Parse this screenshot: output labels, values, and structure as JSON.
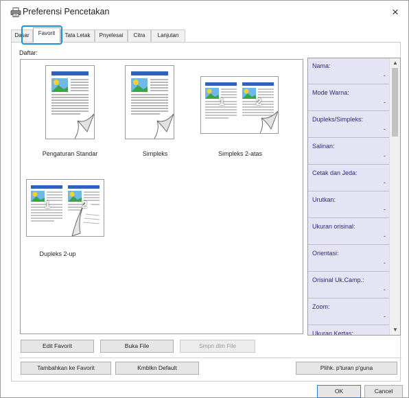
{
  "window": {
    "title": "Preferensi Pencetakan",
    "close_glyph": "×",
    "printer_icon": "printer-icon"
  },
  "tabs": [
    {
      "label": "Dasar",
      "active": false
    },
    {
      "label": "Favorit",
      "active": true
    },
    {
      "label": "Tata Letak",
      "active": false
    },
    {
      "label": "Pnyelesai",
      "active": false
    },
    {
      "label": "Citra",
      "active": false
    },
    {
      "label": "Lanjutan",
      "active": false
    }
  ],
  "list": {
    "label": "Daftar:",
    "items": [
      {
        "caption": "Pengaturan Standar",
        "layout": "single"
      },
      {
        "caption": "Simpleks",
        "layout": "single"
      },
      {
        "caption": "Simpleks 2-atas",
        "layout": "two-up",
        "page_numbers": [
          "1",
          "2"
        ]
      },
      {
        "caption": "Dupleks 2-up",
        "layout": "two-up",
        "page_numbers": [
          "1",
          "2"
        ]
      }
    ]
  },
  "details": {
    "rows": [
      {
        "label": "Nama:",
        "value": "-"
      },
      {
        "label": "Mode Warna:",
        "value": "-"
      },
      {
        "label": "Dupleks/Simpleks:",
        "value": "-"
      },
      {
        "label": "Salinan:",
        "value": "-"
      },
      {
        "label": "Cetak dan Jeda:",
        "value": "-"
      },
      {
        "label": "Urutkan:",
        "value": "-"
      },
      {
        "label": "Ukuran orisinal:",
        "value": "-"
      },
      {
        "label": "Orientasi:",
        "value": "-"
      },
      {
        "label": "Orisinal Uk.Camp.:",
        "value": "-"
      },
      {
        "label": "Zoom:",
        "value": "-"
      },
      {
        "label": "Ukuran Kertas:",
        "value": ""
      }
    ],
    "scroll_up": "▲",
    "scroll_down": "▼"
  },
  "buttons": {
    "edit_favorite": "Edit Favorit",
    "open_file": "Buka File",
    "save_to_file": "Smpn dlm File",
    "add_favorite": "Tambahkan ke Favorit",
    "restore_default": "Kmblkn Default",
    "user_settings": "Plihk. p'turan p'guna",
    "ok": "OK",
    "cancel": "Cancel"
  },
  "colors": {
    "tab_highlight": "#1e90d8",
    "details_bg": "#e4e4f4",
    "details_text": "#2a2a7a",
    "thumb_blue": "#2f62b8",
    "thumb_green": "#3ca34a",
    "thumb_sun": "#f2d230",
    "thumb_lines": "#8a8a8a"
  }
}
